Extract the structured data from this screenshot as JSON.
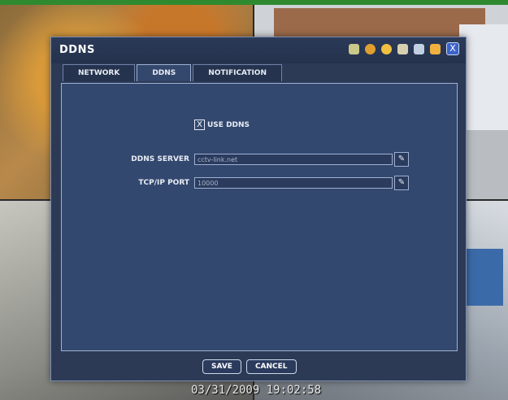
{
  "dialog": {
    "title": "DDNS",
    "toolbar_icons": [
      "camera-icon",
      "record-icon",
      "search-icon",
      "document-icon",
      "network-icon",
      "power-icon"
    ],
    "close_label": "X"
  },
  "tabs": [
    {
      "label": "NETWORK",
      "active": false
    },
    {
      "label": "DDNS",
      "active": true
    },
    {
      "label": "NOTIFICATION",
      "active": false
    }
  ],
  "form": {
    "use_ddns": {
      "checked": true,
      "mark": "X",
      "label": "USE DDNS"
    },
    "ddns_server": {
      "label": "DDNS SERVER",
      "value": "cctv-link.net"
    },
    "tcp_ip_port": {
      "label": "TCP/IP PORT",
      "value": "10000"
    },
    "edit_icon": "pencil-icon"
  },
  "buttons": {
    "save": "SAVE",
    "cancel": "CANCEL"
  },
  "timestamp": "03/31/2009 19:02:58",
  "colors": {
    "dialog_bg": "#2c3a55",
    "panel_bg": "#33486f",
    "border": "#9fb0d2",
    "close_btn": "#3b63c8"
  }
}
